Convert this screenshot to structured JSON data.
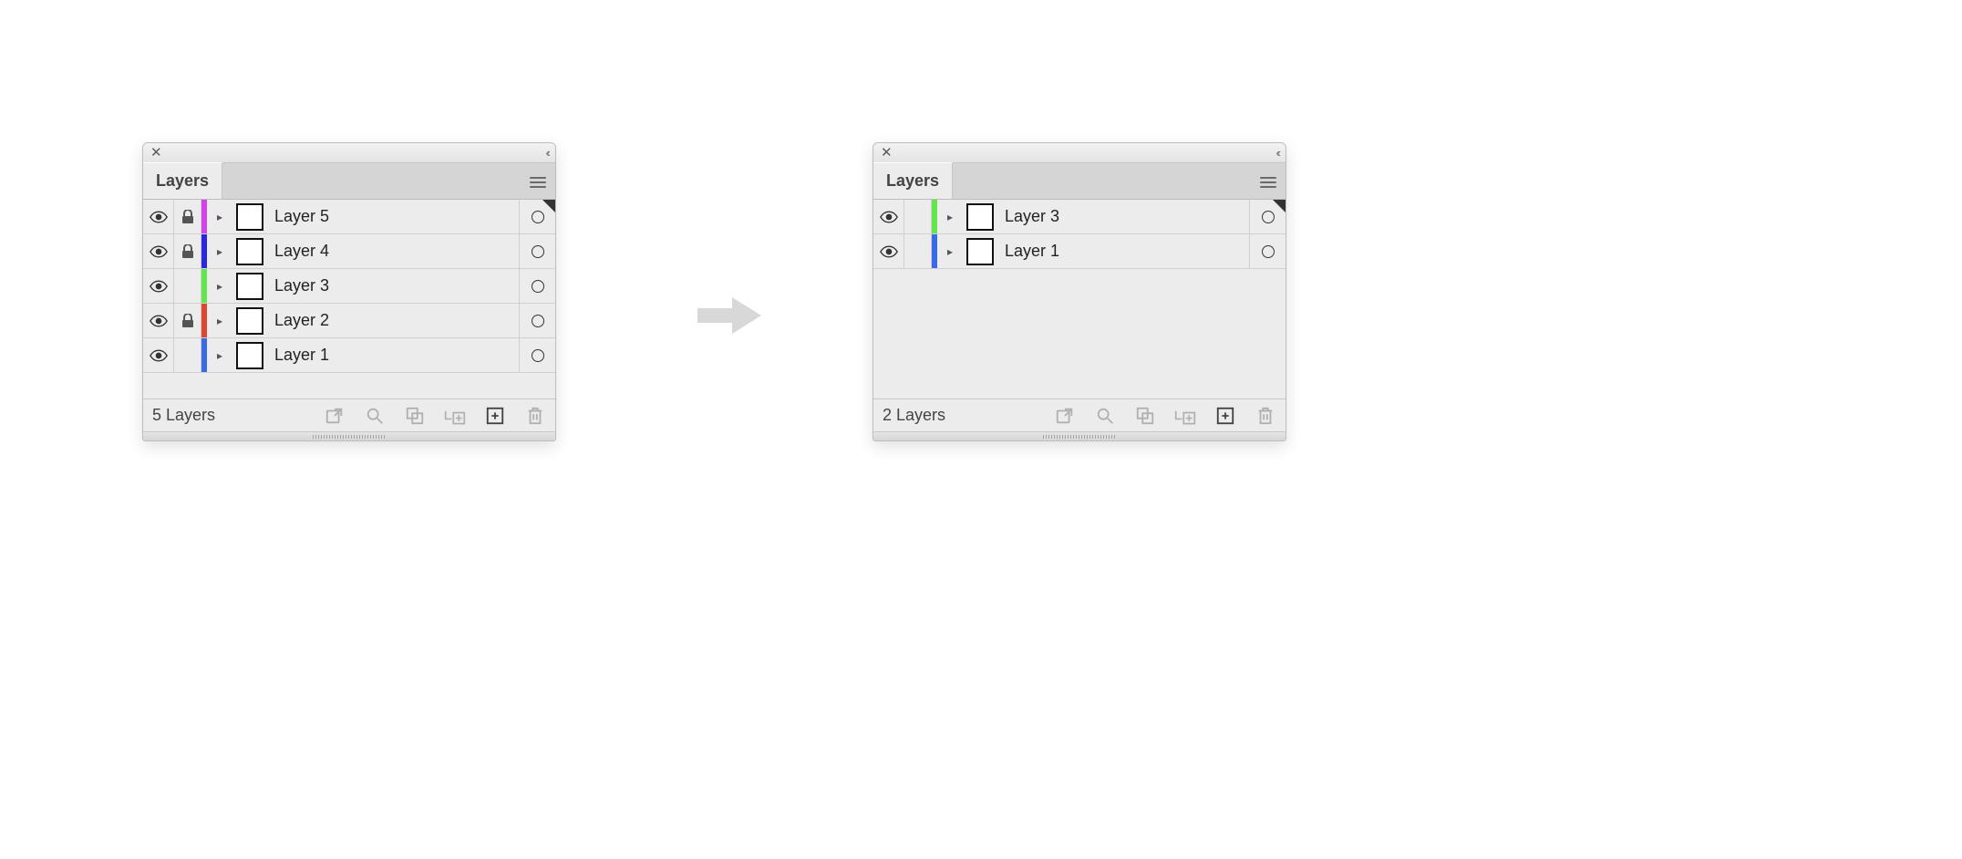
{
  "tab_label": "Layers",
  "panels": [
    {
      "id": "left",
      "footer_count": "5 Layers",
      "layers": [
        {
          "name": "Layer 5",
          "visible": true,
          "locked": true,
          "color": "#d642ea"
        },
        {
          "name": "Layer 4",
          "visible": true,
          "locked": true,
          "color": "#2b24e9"
        },
        {
          "name": "Layer 3",
          "visible": true,
          "locked": false,
          "color": "#62e64b"
        },
        {
          "name": "Layer 2",
          "visible": true,
          "locked": true,
          "color": "#e0452f"
        },
        {
          "name": "Layer 1",
          "visible": true,
          "locked": false,
          "color": "#3a6be7"
        }
      ]
    },
    {
      "id": "right",
      "footer_count": "2 Layers",
      "layers": [
        {
          "name": "Layer 3",
          "visible": true,
          "locked": false,
          "color": "#62e64b"
        },
        {
          "name": "Layer 1",
          "visible": true,
          "locked": false,
          "color": "#3a6be7"
        }
      ]
    }
  ],
  "footer_icons": [
    {
      "id": "share",
      "label": "export-icon"
    },
    {
      "id": "search",
      "label": "search-icon"
    },
    {
      "id": "clip",
      "label": "clipping-mask-icon"
    },
    {
      "id": "sublayer",
      "label": "new-sublayer-icon"
    },
    {
      "id": "new",
      "label": "new-layer-icon"
    },
    {
      "id": "trash",
      "label": "trash-icon"
    }
  ]
}
